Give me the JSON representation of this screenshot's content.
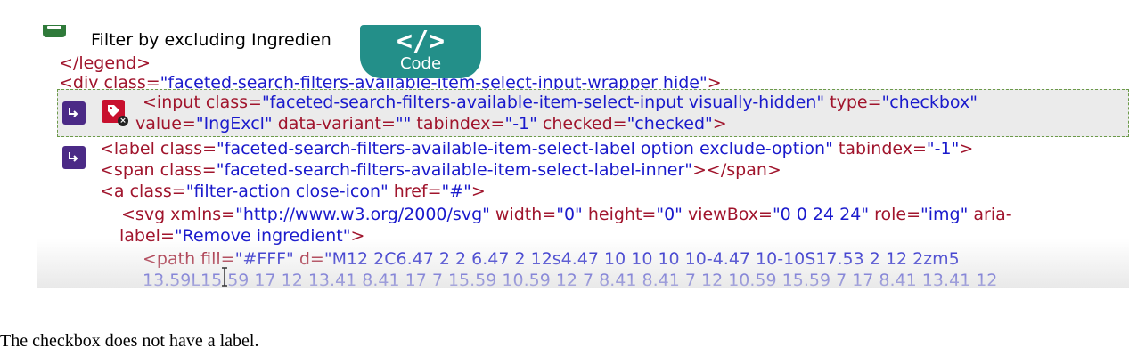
{
  "code_badge": {
    "symbol": "</>",
    "label": "Code"
  },
  "legend_text": "Filter by excluding Ingredien",
  "lines": {
    "l1": {
      "tag": "</legend>"
    },
    "l2": {
      "open": "<div ",
      "a1": "class=",
      "v1": "\"faceted-search-filters-available-item-select-input-wrapper hide\"",
      "close": ">"
    },
    "l3": {
      "open": "<input ",
      "a1": "class=",
      "v1": "\"faceted-search-filters-available-item-select-input visually-hidden\"",
      "a2": " type=",
      "v2": "\"checkbox\""
    },
    "l4": {
      "a1": "value=",
      "v1": "\"IngExcl\"",
      "a2": " data-variant=",
      "v2": "\"\"",
      "a3": " tabindex=",
      "v3": "\"-1\"",
      "a4": " checked=",
      "v4": "\"checked\"",
      "close": ">"
    },
    "l5": {
      "open": "<label ",
      "a1": "class=",
      "v1": "\"faceted-search-filters-available-item-select-label option exclude-option\"",
      "a2": " tabindex=",
      "v2": "\"-1\"",
      "close": ">"
    },
    "l6": {
      "open": "<span ",
      "a1": "class=",
      "v1": "\"faceted-search-filters-available-item-select-label-inner\"",
      "close": "></span>"
    },
    "l7": {
      "open": "<a ",
      "a1": "class=",
      "v1": "\"filter-action close-icon\"",
      "a2": " href=",
      "v2": "\"#\"",
      "close": ">"
    },
    "l8": {
      "open": "<svg ",
      "a1": "xmlns=",
      "v1": "\"http://www.w3.org/2000/svg\"",
      "a2": " width=",
      "v2": "\"0\"",
      "a3": " height=",
      "v3": "\"0\"",
      "a4": " viewBox=",
      "v4": "\"0 0 24 24\"",
      "a5": " role=",
      "v5": "\"img\"",
      "a6": " aria-"
    },
    "l9": {
      "a1": "label=",
      "v1": "\"Remove ingredient\"",
      "close": ">"
    },
    "l10": {
      "open": "<path ",
      "a1": "fill=",
      "v1": "\"#FFF\"",
      "a2": " d=",
      "v2": "\"M12 2C6.47 2 2 6.47 2 12s4.47 10 10 10 10-4.47 10-10S17.53 2 12 2zm5"
    },
    "l11": {
      "v1": "13.59L15.59 17 12 13.41 8.41 17 7 15.59 10.59 12 7 8.41 8.41 7 12 10.59 15.59 7 17 8.41 13.41 12"
    }
  },
  "caption": "The checkbox does not have a label.",
  "colors": {
    "tag": "#a0142c",
    "value": "#1a1acc",
    "badge": "#238f89",
    "purple": "#4b2a86",
    "red": "#c8102e",
    "green": "#2f7a3a"
  },
  "icons": [
    "green-element-icon",
    "purple-arrow-icon",
    "red-tag-error-icon",
    "text-cursor-icon"
  ]
}
